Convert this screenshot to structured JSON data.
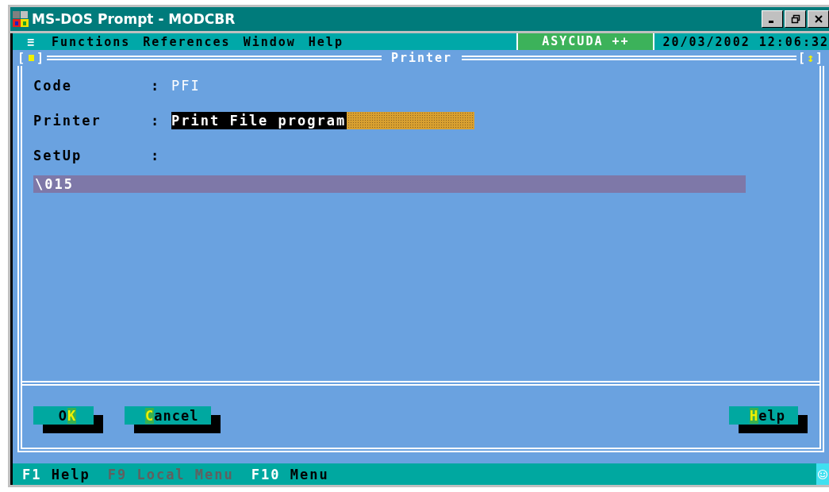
{
  "window": {
    "title": "MS-DOS Prompt - MODCBR"
  },
  "menu_bar": {
    "items": [
      {
        "label": "≡"
      },
      {
        "label": "Functions"
      },
      {
        "label": "References"
      },
      {
        "label": "Window"
      },
      {
        "label": "Help"
      }
    ],
    "badge": "ASYCUDA ++",
    "datetime": "20/03/2002 12:06:32"
  },
  "dialog": {
    "title": "Printer",
    "close_box": {
      "left": "[",
      "right": "]"
    },
    "resize_box": {
      "left": "[",
      "glyph": "↕",
      "right": "]"
    },
    "fields": [
      {
        "kind": "text",
        "label": "Code",
        "separator": ":",
        "value": "PFI"
      },
      {
        "kind": "input",
        "label": "Printer",
        "separator": ":",
        "value": "Print File program",
        "selected": true
      },
      {
        "kind": "block",
        "label": "SetUp",
        "separator": ":",
        "value": "\\015"
      }
    ],
    "left_buttons": [
      {
        "before": "O",
        "hotkey": "K"
      },
      {
        "hotkey": "C",
        "after": "ancel"
      }
    ],
    "right_buttons": [
      {
        "hotkey": "H",
        "after": "elp"
      }
    ]
  },
  "status_bar": [
    {
      "key": "F1",
      "label": "Help",
      "disabled": false
    },
    {
      "key": "F9",
      "label": "Local Menu",
      "disabled": true
    },
    {
      "key": "F10",
      "label": "Menu",
      "disabled": false
    }
  ]
}
